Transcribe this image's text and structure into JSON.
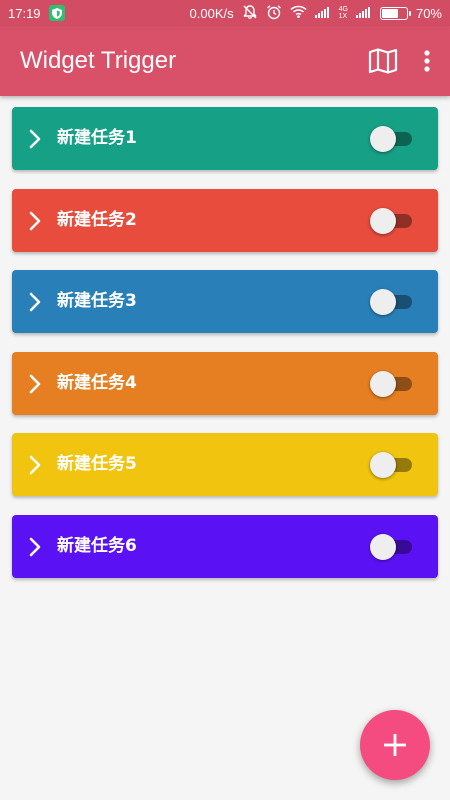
{
  "status_bar": {
    "time": "17:19",
    "net_speed": "0.00K/s",
    "network_type_top": "4G",
    "network_type_bottom": "1X",
    "battery": "70%",
    "battery_level": 0.7,
    "background_color": "#d24d64"
  },
  "app_bar": {
    "title": "Widget Trigger",
    "background_color": "#d85168",
    "actions": [
      {
        "icon": "map-icon"
      },
      {
        "icon": "more-vert-icon"
      }
    ]
  },
  "tasks": [
    {
      "label": "新建任务1",
      "color": "#16a085",
      "enabled": false
    },
    {
      "label": "新建任务2",
      "color": "#e74c3c",
      "enabled": false
    },
    {
      "label": "新建任务3",
      "color": "#2980b9",
      "enabled": false
    },
    {
      "label": "新建任务4",
      "color": "#e67e22",
      "enabled": false
    },
    {
      "label": "新建任务5",
      "color": "#f1c40f",
      "enabled": false
    },
    {
      "label": "新建任务6",
      "color": "#5a12f5",
      "enabled": false
    }
  ],
  "fab": {
    "icon": "plus-icon",
    "color": "#f44c80"
  }
}
